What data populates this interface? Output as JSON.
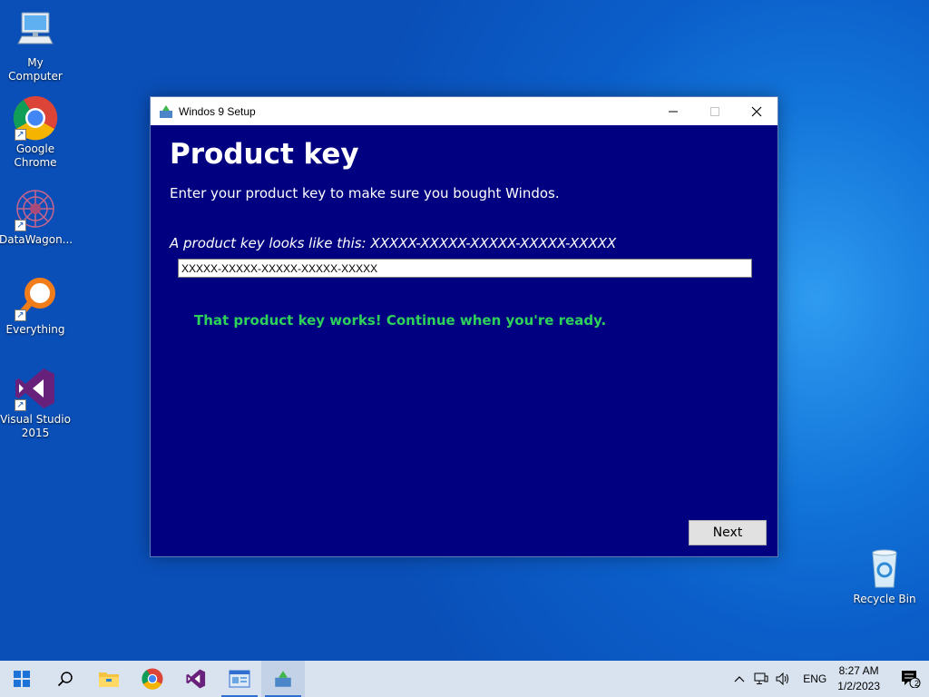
{
  "desktop": {
    "icons": [
      {
        "label": "My Computer",
        "icon": "computer-icon"
      },
      {
        "label": "Google Chrome",
        "icon": "chrome-icon"
      },
      {
        "label": "DataWagon...",
        "icon": "datawagon-icon"
      },
      {
        "label": "Everything",
        "icon": "everything-icon"
      },
      {
        "label": "Visual Studio 2015",
        "icon": "visual-studio-icon"
      },
      {
        "label": "Recycle Bin",
        "icon": "recycle-bin-icon"
      }
    ]
  },
  "window": {
    "title": "Windos 9 Setup",
    "heading": "Product key",
    "subheading": "Enter your product key to make sure you bought Windos.",
    "hint": "A product key looks like this: XXXXX-XXXXX-XXXXX-XXXXX-XXXXX",
    "key_value": "XXXXX-XXXXX-XXXXX-XXXXX-XXXXX",
    "success_message": "That product key works! Continue when you're ready.",
    "next_label": "Next",
    "colors": {
      "background": "#000080",
      "success": "#2ed15a"
    }
  },
  "taskbar": {
    "language": "ENG",
    "time": "8:27 AM",
    "date": "1/2/2023",
    "notification_count": "2"
  }
}
